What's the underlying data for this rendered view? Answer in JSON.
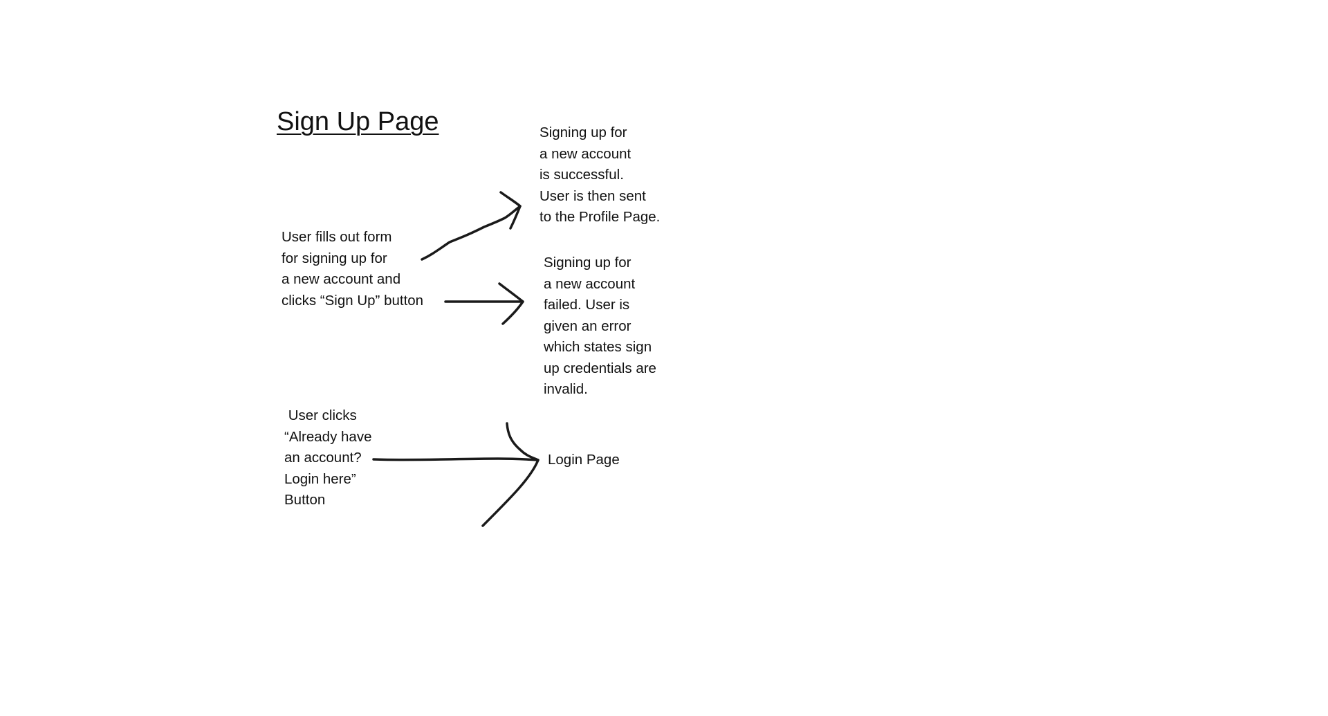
{
  "title": "Sign Up Page",
  "nodes": {
    "signup_form": "User fills out form\nfor signing up for\na new account and\nclicks “Sign Up” button",
    "success": "Signing up for\na new account\nis successful.\nUser is then sent\nto the Profile Page.",
    "failed": "Signing up for\na new account\nfailed. User is\ngiven an error\nwhich states sign\nup credentials are\ninvalid.",
    "login_click": " User clicks\n“Already have\nan account?\nLogin here”\nButton",
    "login_page": "Login Page"
  },
  "edges": [
    {
      "from": "signup_form",
      "to": "success"
    },
    {
      "from": "signup_form",
      "to": "failed"
    },
    {
      "from": "login_click",
      "to": "login_page"
    }
  ]
}
